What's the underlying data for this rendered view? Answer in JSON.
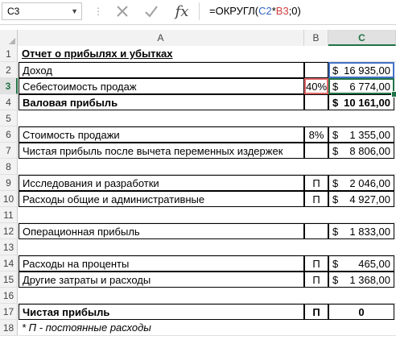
{
  "formula_bar": {
    "name_box": "C3",
    "formula_prefix": "=ОКРУГЛ(",
    "ref1": "C2",
    "op": "*",
    "ref2": "B3",
    "formula_suffix": ";0)"
  },
  "columns": [
    "A",
    "B",
    "C"
  ],
  "selected_column": "C",
  "rows": [
    {
      "num": "1",
      "a": "Отчет о прибылях и убытках",
      "b": "",
      "c_sym": "",
      "c_val": ""
    },
    {
      "num": "2",
      "a": "Доход",
      "b": "",
      "c_sym": "$",
      "c_val": "16 935,00"
    },
    {
      "num": "3",
      "a": "Себестоимость продаж",
      "b": "40%",
      "c_sym": "$",
      "c_val": "6 774,00"
    },
    {
      "num": "4",
      "a": "Валовая прибыль",
      "b": "",
      "c_sym": "$",
      "c_val": "10 161,00"
    },
    {
      "num": "5",
      "a": "",
      "b": "",
      "c_sym": "",
      "c_val": ""
    },
    {
      "num": "6",
      "a": "Стоимость продажи",
      "b": "8%",
      "c_sym": "$",
      "c_val": "1 355,00"
    },
    {
      "num": "7",
      "a": "Чистая прибыль после вычета переменных издержек",
      "b": "",
      "c_sym": "$",
      "c_val": "8 806,00"
    },
    {
      "num": "8",
      "a": "",
      "b": "",
      "c_sym": "",
      "c_val": ""
    },
    {
      "num": "9",
      "a": "Исследования и разработки",
      "b": "П",
      "c_sym": "$",
      "c_val": "2 046,00"
    },
    {
      "num": "10",
      "a": "Расходы общие и административные",
      "b": "П",
      "c_sym": "$",
      "c_val": "4 927,00"
    },
    {
      "num": "11",
      "a": "",
      "b": "",
      "c_sym": "",
      "c_val": ""
    },
    {
      "num": "12",
      "a": "Операционная прибыль",
      "b": "",
      "c_sym": "$",
      "c_val": "1 833,00"
    },
    {
      "num": "13",
      "a": "",
      "b": "",
      "c_sym": "",
      "c_val": ""
    },
    {
      "num": "14",
      "a": "Расходы на проценты",
      "b": "П",
      "c_sym": "$",
      "c_val": "465,00"
    },
    {
      "num": "15",
      "a": "Другие затраты и расходы",
      "b": "П",
      "c_sym": "$",
      "c_val": "1 368,00"
    },
    {
      "num": "16",
      "a": "",
      "b": "",
      "c_sym": "",
      "c_val": ""
    },
    {
      "num": "17",
      "a": "Чистая прибыль",
      "b": "П",
      "c_sym": "",
      "c_val": "0"
    },
    {
      "num": "18",
      "a": "* П - постоянные расходы",
      "b": "",
      "c_sym": "",
      "c_val": ""
    }
  ],
  "colors": {
    "selection": "#217346",
    "ref_c2": "#4472c4",
    "ref_b3": "#e06666"
  }
}
